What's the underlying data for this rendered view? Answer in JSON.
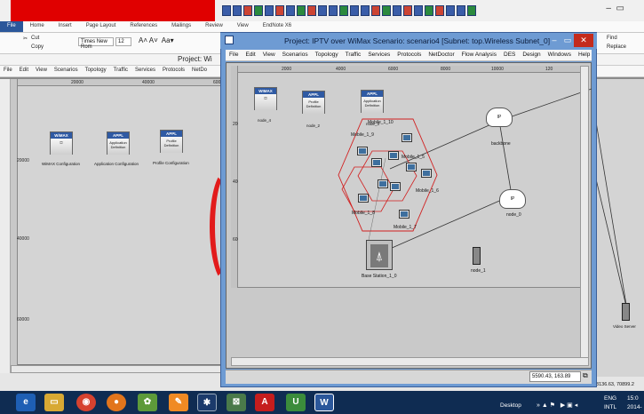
{
  "word": {
    "tabs": [
      "File",
      "Home",
      "Insert",
      "Page Layout",
      "References",
      "Mailings",
      "Review",
      "View",
      "EndNote X6"
    ],
    "font_name": "Times New Rom",
    "font_size": "12",
    "cut_label": "Cut",
    "copy_label": "Copy",
    "find_label": "Find",
    "replace_label": "Replace"
  },
  "bg_window": {
    "title": "Project: Wi",
    "menu": [
      "File",
      "Edit",
      "View",
      "Scenarios",
      "Topology",
      "Traffic",
      "Services",
      "Protocols",
      "NetDo"
    ],
    "ruler_x": [
      "20000",
      "40000",
      "600"
    ],
    "ruler_y": [
      "20000",
      "40000",
      "60000"
    ],
    "nodes": [
      {
        "header": "WiMAX",
        "body": "",
        "label": "WiMAX Configuration"
      },
      {
        "header": "APPL",
        "body": "Application Definition",
        "label": "Application Configuration"
      },
      {
        "header": "APPL",
        "body": "Profile Definition",
        "label": "Profile Configuration"
      }
    ],
    "right_node_label": "Video Server",
    "right_status": "78136.63, 70899.2"
  },
  "front_window": {
    "title": "Project: IPTV over WiMax Scenario: scenario4  [Subnet: top.Wireless Subnet_0]",
    "controls": {
      "minimize": "–",
      "maximize": "▭",
      "close": "✕"
    },
    "menu": [
      "File",
      "Edit",
      "View",
      "Scenarios",
      "Topology",
      "Traffic",
      "Services",
      "Protocols",
      "NetDoctor",
      "Flow Analysis",
      "DES",
      "Design",
      "Windows",
      "Help"
    ],
    "ruler_x": [
      "0",
      "2000",
      "4000",
      "6000",
      "8000",
      "10000",
      "120"
    ],
    "ruler_y": [
      "2000",
      "4000",
      "6000"
    ],
    "config_nodes": [
      {
        "header": "WIMAX",
        "body": "",
        "label": "node_4"
      },
      {
        "header": "APPL",
        "body": "Profile Definition",
        "label": "node_2"
      },
      {
        "header": "APPL",
        "body": "Application Definition",
        "label": "node_3"
      }
    ],
    "mobiles": [
      "Mobile_1_9",
      "Mobile_1_10",
      "Mobile_1_5",
      "Mobile_1_6",
      "Mobile_1_8",
      "Mobile_1_7"
    ],
    "base_station": "Base Station_1_0",
    "backbone": {
      "text": "IP",
      "label": "backbone"
    },
    "ip_cloud": {
      "text": "IP",
      "label": "node_0"
    },
    "server": "node_1",
    "coords": "5590.43, 163.89"
  },
  "taskbar": {
    "desktop": "Desktop",
    "lang_top": "ENG",
    "lang_bottom": "INTL",
    "time": "15:0",
    "date": "2014-"
  },
  "colors": {
    "word_red": "#e00000",
    "window_frame": "#6e9bd3",
    "close_btn": "#c42b1c",
    "hex_outline": "#d11f1f",
    "taskbar": "#0f2c52"
  }
}
